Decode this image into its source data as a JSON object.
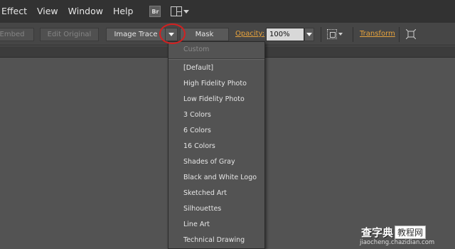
{
  "menubar": {
    "items": [
      "Effect",
      "View",
      "Window",
      "Help"
    ],
    "bridge_label": "Br"
  },
  "controlbar": {
    "embed_label": "Embed",
    "edit_original_label": "Edit Original",
    "image_trace_label": "Image Trace",
    "mask_label": "Mask",
    "opacity_label": "Opacity:",
    "opacity_value": "100%",
    "transform_label": "Transform"
  },
  "trace_presets": {
    "items": [
      {
        "label": "Custom",
        "enabled": false
      },
      {
        "label": "[Default]",
        "enabled": true
      },
      {
        "label": "High Fidelity Photo",
        "enabled": true
      },
      {
        "label": "Low Fidelity Photo",
        "enabled": true
      },
      {
        "label": "3 Colors",
        "enabled": true
      },
      {
        "label": "6 Colors",
        "enabled": true
      },
      {
        "label": "16 Colors",
        "enabled": true
      },
      {
        "label": "Shades of Gray",
        "enabled": true
      },
      {
        "label": "Black and White Logo",
        "enabled": true
      },
      {
        "label": "Sketched Art",
        "enabled": true
      },
      {
        "label": "Silhouettes",
        "enabled": true
      },
      {
        "label": "Line Art",
        "enabled": true
      },
      {
        "label": "Technical Drawing",
        "enabled": true
      }
    ]
  },
  "watermark": {
    "brand": "查字典",
    "tag": "教程网",
    "url": "jiaocheng.chazidian.com"
  },
  "colors": {
    "accent_link": "#e8a33c",
    "highlight_circle": "#d42020",
    "workspace": "#535353"
  }
}
